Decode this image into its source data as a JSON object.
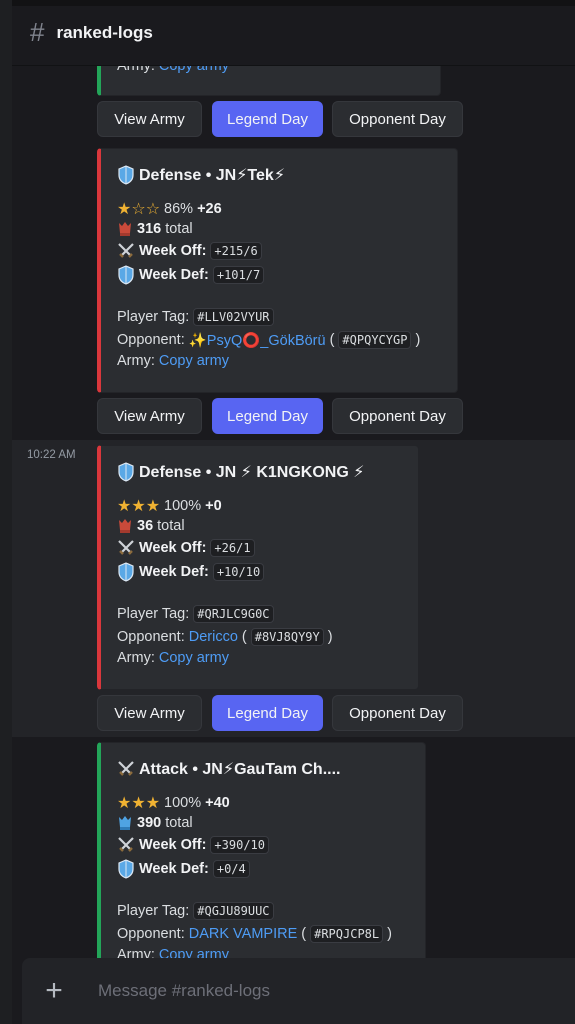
{
  "channel": {
    "hash": "#",
    "name": "ranked-logs"
  },
  "composer": {
    "plus": "+",
    "placeholder": "Message #ranked-logs"
  },
  "buttons": {
    "view_army": "View Army",
    "legend_day": "Legend Day",
    "opponent_day": "Opponent Day"
  },
  "labels": {
    "total": "total",
    "week_off": "Week Off:",
    "week_def": "Week Def:",
    "player_tag": "Player Tag:",
    "opponent": "Opponent:",
    "army": "Army:",
    "copy_army": "Copy army"
  },
  "top_partial": {
    "army_label": "Army:",
    "army_link": "Copy army"
  },
  "messages": [
    {
      "timestamp": "",
      "type": "Defense",
      "title": "Defense • JN⚡Tek⚡",
      "stars": "★☆☆",
      "percent": "86%",
      "delta": "+26",
      "trophies": "316",
      "week_off": "+215/6",
      "week_def": "+101/7",
      "player_tag": "#LLV02VYUR",
      "opponent_name": "✨PsyQ⭕_GökBörü",
      "opponent_tag": "#QPQYCYGP",
      "accent": "#da373c"
    },
    {
      "timestamp": "10:22 AM",
      "type": "Defense",
      "title": "Defense • JN ⚡ K1NGKONG ⚡",
      "stars": "★★★",
      "percent": "100%",
      "delta": "+0",
      "trophies": "36",
      "week_off": "+26/1",
      "week_def": "+10/10",
      "player_tag": "#QRJLC9G0C",
      "opponent_name": "Dericco",
      "opponent_tag": "#8VJ8QY9Y",
      "accent": "#da373c"
    },
    {
      "timestamp": "",
      "type": "Attack",
      "title": "Attack • JN⚡GauTam Ch....",
      "stars": "★★★",
      "percent": "100%",
      "delta": "+40",
      "trophies": "390",
      "week_off": "+390/10",
      "week_def": "+0/4",
      "player_tag": "#QGJU89UUC",
      "opponent_name": "DARK VAMPIRE",
      "opponent_tag": "#RPQJCP8L",
      "accent": "#23a559"
    }
  ],
  "colors": {
    "accent": "#5865f2",
    "defense": "#da373c",
    "attack": "#23a559",
    "link": "#4e9cf5"
  },
  "icons": [
    "hash-icon",
    "shield-icon",
    "swords-icon",
    "trophy-icon",
    "plus-icon"
  ]
}
